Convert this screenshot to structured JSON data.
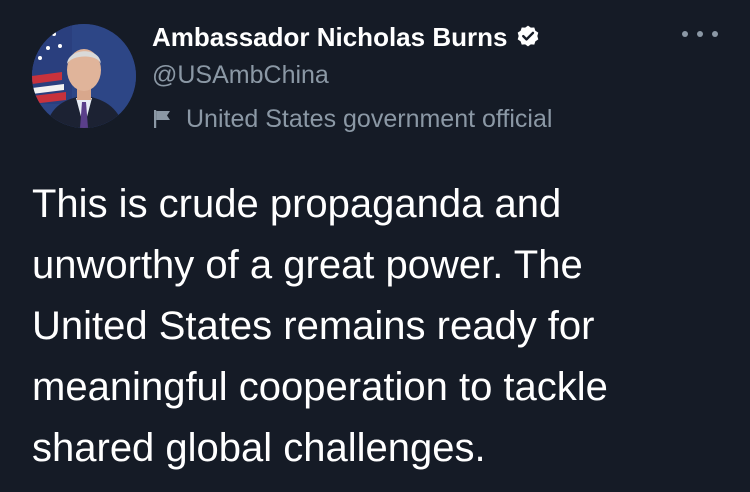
{
  "author": {
    "display_name": "Ambassador Nicholas Burns",
    "handle": "@USAmbChina",
    "account_label": "United States government official",
    "verified_icon": "verified-badge",
    "label_icon": "flag-icon"
  },
  "tweet": {
    "text_lines": [
      "This is crude propaganda and",
      "unworthy of a great power. The",
      "United States remains ready for",
      "meaningful cooperation to tackle",
      "shared global challenges."
    ]
  },
  "colors": {
    "background": "#151b26",
    "primary_text": "#ffffff",
    "secondary_text": "#8b98a5"
  }
}
